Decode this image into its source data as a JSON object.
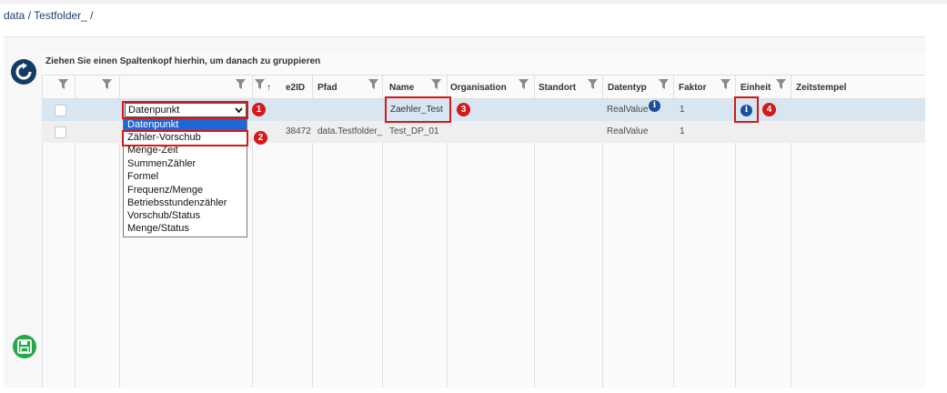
{
  "breadcrumb": "data / Testfolder_ /",
  "grid": {
    "group_hint": "Ziehen Sie einen Spaltenkopf hierhin, um danach zu gruppieren",
    "columns": {
      "e2id": "e2ID",
      "pfad": "Pfad",
      "name": "Name",
      "organisation": "Organisation",
      "standort": "Standort",
      "datentyp": "Datentyp",
      "faktor": "Faktor",
      "einheit": "Einheit",
      "zeitstempel": "Zeitstempel"
    },
    "sort_indicator": "↑",
    "rows": [
      {
        "e2id": "",
        "pfad": "",
        "name": "Zaehler_Test",
        "organisation": "",
        "standort": "",
        "datentyp": "RealValue",
        "faktor": "1",
        "einheit": ""
      },
      {
        "e2id": "38472",
        "pfad": "data.Testfolder_",
        "name": "Test_DP_01",
        "organisation": "",
        "standort": "",
        "datentyp": "RealValue",
        "faktor": "1",
        "einheit": ""
      }
    ]
  },
  "type_dropdown": {
    "selected": "Datenpunkt",
    "options": [
      "Datenpunkt",
      "Zähler-Vorschub",
      "Menge-Zeit",
      "SummenZähler",
      "Formel",
      "Frequenz/Menge",
      "Betriebsstundenzähler",
      "Vorschub/Status",
      "Menge/Status"
    ]
  },
  "callouts": [
    "1",
    "2",
    "3",
    "4"
  ],
  "info_icon_glyph": "i",
  "colors": {
    "selected_row": "#d7e6f1",
    "callout_red": "#d41919",
    "option_highlight": "#1f66d6",
    "refresh_button": "#123b66",
    "save_button": "#27a84a"
  },
  "icons": [
    "refresh-icon",
    "save-icon",
    "filter-icon",
    "info-icon",
    "chevron-down-icon"
  ]
}
